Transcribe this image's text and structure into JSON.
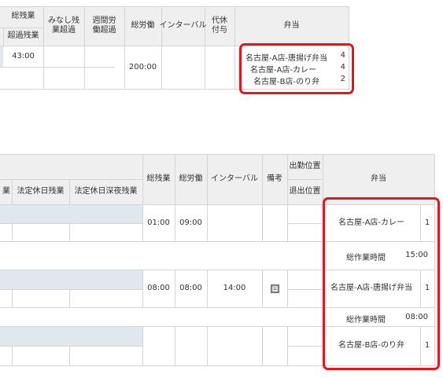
{
  "top_table": {
    "headers": {
      "total_overtime": "総残業",
      "excess_overtime": "超過残業",
      "deemed_overtime_excess": "みなし残業超過",
      "weekly_labor_excess": "週間労働超過",
      "total_labor": "総労働",
      "interval": "インターバル",
      "comp_leave_grant": "代休付与",
      "bento": "弁当"
    },
    "row": {
      "excess_overtime": "43:00",
      "total_labor": "200:00",
      "bento": [
        {
          "name": "名古屋-A店-唐揚げ弁当",
          "qty": "4"
        },
        {
          "name": "名古屋-A店-カレー",
          "qty": "4"
        },
        {
          "name": "名古屋-B店-のり弁",
          "qty": "2"
        }
      ]
    }
  },
  "bottom_table": {
    "headers": {
      "partial_overtime": "業",
      "legal_holiday_overtime": "法定休日残業",
      "legal_holiday_late_overtime": "法定休日深夜残業",
      "total_overtime": "総残業",
      "total_labor": "総労働",
      "interval": "インターバル",
      "remarks": "備考",
      "clock_in_location": "出勤位置",
      "clock_out_location": "退出位置",
      "bento": "弁当"
    },
    "rows": [
      {
        "total_overtime": "01:00",
        "total_labor": "09:00",
        "interval": "",
        "bento_name": "名古屋-A店-カレー",
        "bento_qty": "1"
      },
      {
        "total_overtime": "08:00",
        "total_labor": "08:00",
        "interval": "14:00",
        "bento_name": "名古屋-A店-唐揚げ弁当",
        "bento_qty": "1"
      },
      {
        "total_overtime": "",
        "total_labor": "",
        "interval": "",
        "bento_name": "名古屋-B店-のり弁",
        "bento_qty": "1"
      }
    ],
    "summaries": [
      {
        "label": "総作業時間",
        "value": "15:00"
      },
      {
        "label": "総作業時間",
        "value": "08:00"
      }
    ]
  },
  "colors": {
    "highlight_border": "#e8141a",
    "header_bg": "#efefef",
    "row_highlight": "#dfe7ef"
  },
  "icons": {
    "remarks_note": "note-icon"
  }
}
